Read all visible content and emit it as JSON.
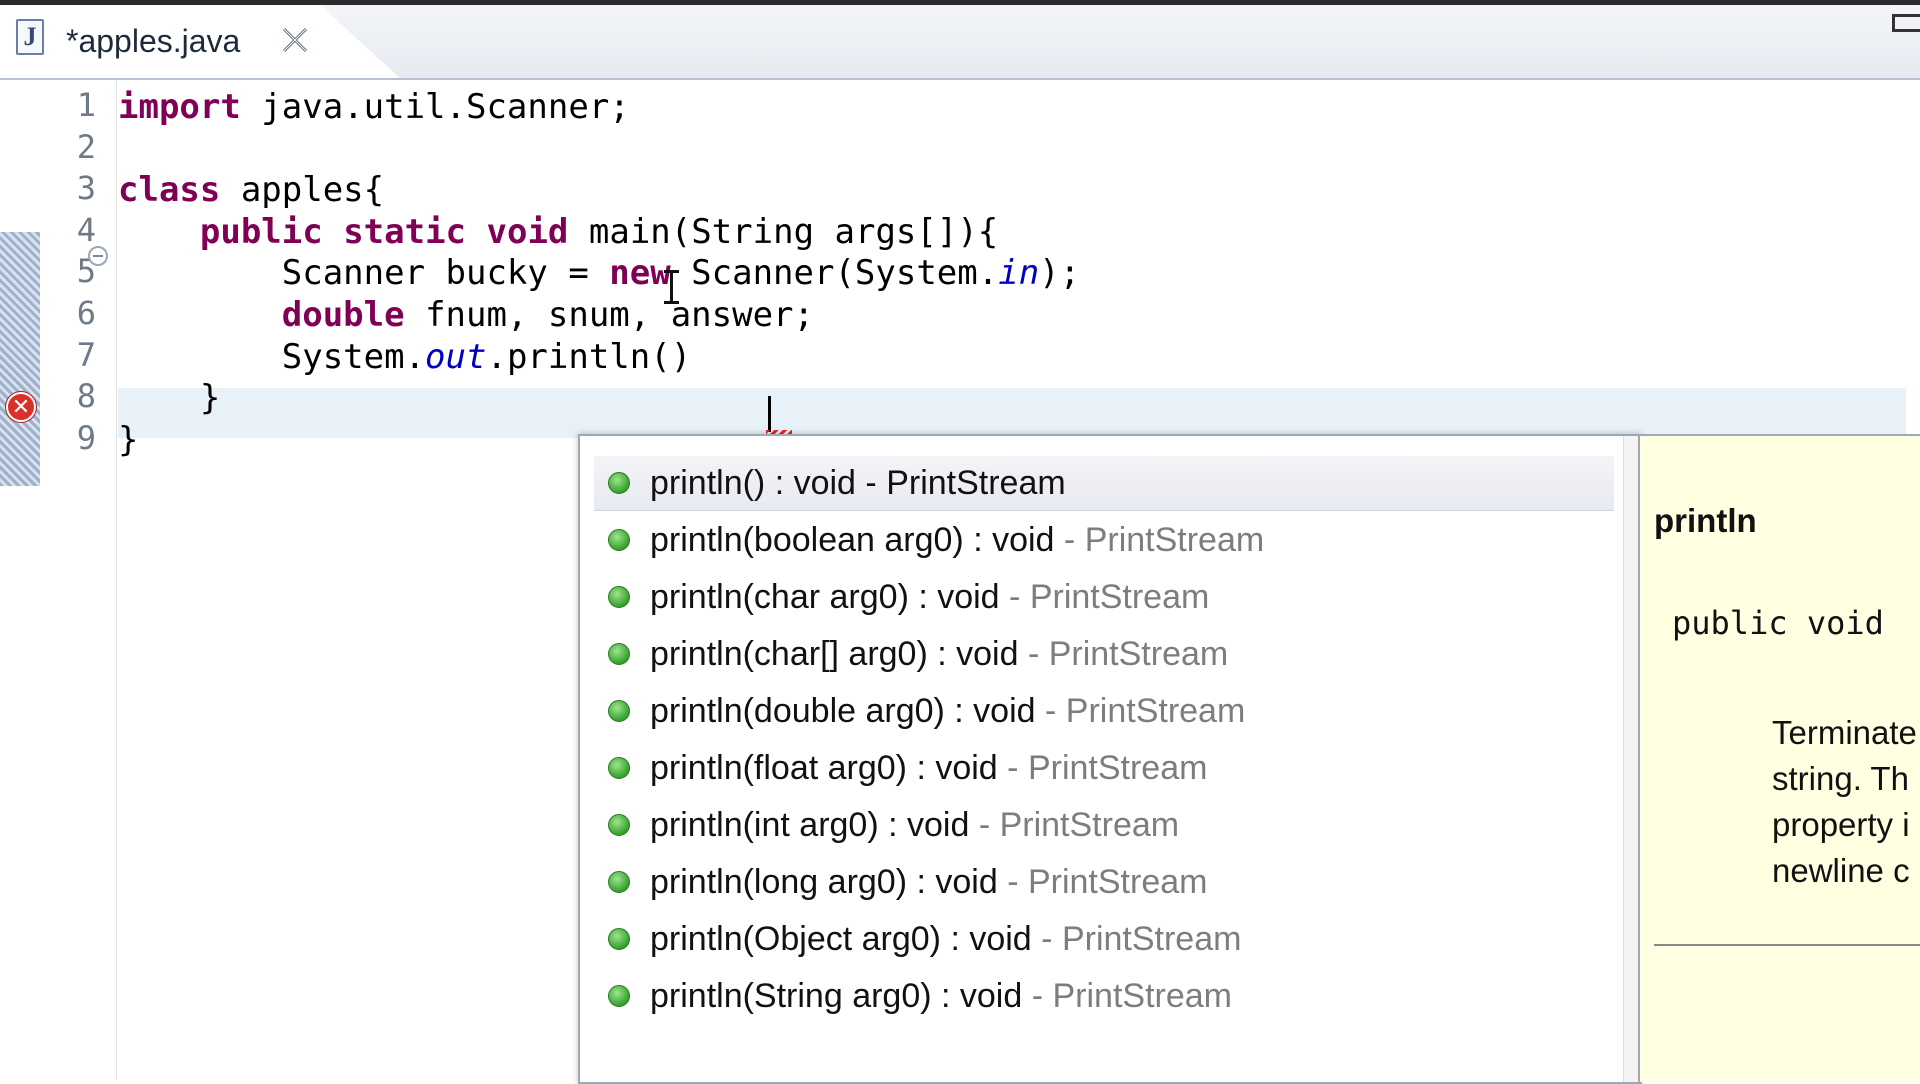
{
  "tab": {
    "name": "*apples.java",
    "icon": "java-file-icon",
    "close_icon": "close-icon"
  },
  "editor": {
    "line_numbers": [
      "1",
      "2",
      "3",
      "4",
      "5",
      "6",
      "7",
      "8",
      "9"
    ],
    "lines": [
      [
        {
          "t": "import",
          "k": "kw"
        },
        {
          "t": " java.util.Scanner;"
        }
      ],
      [],
      [
        {
          "t": "class",
          "k": "kw"
        },
        {
          "t": " apples{"
        }
      ],
      [
        {
          "t": "    "
        },
        {
          "t": "public",
          "k": "kw"
        },
        {
          "t": " "
        },
        {
          "t": "static",
          "k": "kw"
        },
        {
          "t": " "
        },
        {
          "t": "void",
          "k": "kw"
        },
        {
          "t": " main(String args[]){"
        }
      ],
      [
        {
          "t": "        Scanner bucky = "
        },
        {
          "t": "new",
          "k": "kw"
        },
        {
          "t": " Scanner(System."
        },
        {
          "t": "in",
          "k": "fld"
        },
        {
          "t": ");"
        }
      ],
      [
        {
          "t": "        "
        },
        {
          "t": "double",
          "k": "kw"
        },
        {
          "t": " fnum, snum, answer;"
        }
      ],
      [
        {
          "t": "        System."
        },
        {
          "t": "out",
          "k": "fld"
        },
        {
          "t": ".println()"
        }
      ],
      [
        {
          "t": "    }"
        }
      ],
      [
        {
          "t": "}"
        }
      ]
    ],
    "current_line": 7,
    "error_line": 7,
    "error_icon": "error-icon"
  },
  "content_assist": {
    "items": [
      {
        "sig": "println() : void",
        "owner": "PrintStream"
      },
      {
        "sig": "println(boolean arg0) : void",
        "owner": "PrintStream"
      },
      {
        "sig": "println(char arg0) : void",
        "owner": "PrintStream"
      },
      {
        "sig": "println(char[] arg0) : void",
        "owner": "PrintStream"
      },
      {
        "sig": "println(double arg0) : void",
        "owner": "PrintStream"
      },
      {
        "sig": "println(float arg0) : void",
        "owner": "PrintStream"
      },
      {
        "sig": "println(int arg0) : void",
        "owner": "PrintStream"
      },
      {
        "sig": "println(long arg0) : void",
        "owner": "PrintStream"
      },
      {
        "sig": "println(Object arg0) : void",
        "owner": "PrintStream"
      },
      {
        "sig": "println(String arg0) : void",
        "owner": "PrintStream"
      }
    ],
    "selected_index": 0,
    "separator": " - ",
    "item_icon": "public-method-icon"
  },
  "javadoc": {
    "title": "println",
    "declaration": "public void",
    "description_lines": [
      "Terminate",
      "string. Th",
      "property i",
      "newline c"
    ]
  }
}
